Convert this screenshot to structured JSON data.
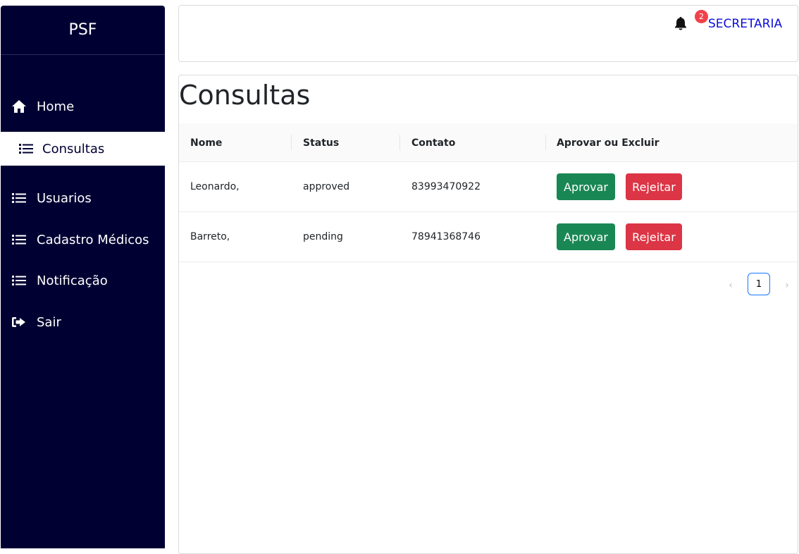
{
  "sidebar": {
    "brand": "PSF",
    "items": [
      {
        "label": "Home",
        "icon": "home-icon"
      },
      {
        "label": "Consultas",
        "icon": "list-icon",
        "active": true
      },
      {
        "label": "Usuarios",
        "icon": "list-icon"
      },
      {
        "label": "Cadastro Médicos",
        "icon": "list-icon"
      },
      {
        "label": "Notificação",
        "icon": "list-icon"
      },
      {
        "label": "Sair",
        "icon": "sign-out-icon"
      }
    ]
  },
  "header": {
    "notification_count": "2",
    "user_label": "SECRETARIA"
  },
  "main": {
    "title": "Consultas",
    "table": {
      "columns": [
        "Nome",
        "Status",
        "Contato",
        "Aprovar ou Excluir"
      ],
      "rows": [
        {
          "nome": "Leonardo,",
          "status": "approved",
          "contato": "83993470922",
          "approve_label": "Aprovar",
          "reject_label": "Rejeitar"
        },
        {
          "nome": "Barreto,",
          "status": "pending",
          "contato": "78941368746",
          "approve_label": "Aprovar",
          "reject_label": "Rejeitar"
        }
      ]
    },
    "pagination": {
      "prev": "‹",
      "current_page": "1",
      "next": "›"
    }
  },
  "colors": {
    "sidebar_bg": "#000033",
    "approve": "#198754",
    "reject": "#dc3545",
    "badge": "#f0424b",
    "user_link": "#0d0dd6"
  }
}
